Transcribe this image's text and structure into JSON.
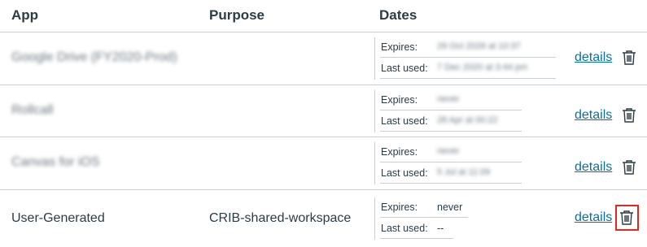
{
  "columns": {
    "app": "App",
    "purpose": "Purpose",
    "dates": "Dates"
  },
  "rows": [
    {
      "app": "Google Drive (FY2020-Prod)",
      "purpose": "",
      "expires_label": "Expires:",
      "expires": "29 Oct 2026 at 10:37",
      "last_used_label": "Last used:",
      "last_used": "7 Dec 2020 at 3:44 pm",
      "details": "details",
      "icon": "trash-icon"
    },
    {
      "app": "Rollcall",
      "purpose": "",
      "expires_label": "Expires:",
      "expires": "never",
      "last_used_label": "Last used:",
      "last_used": "28 Apr at 00:22",
      "details": "details",
      "icon": "trash-icon"
    },
    {
      "app": "Canvas for iOS",
      "purpose": "",
      "expires_label": "Expires:",
      "expires": "never",
      "last_used_label": "Last used:",
      "last_used": "5 Jul at 11:09",
      "details": "details",
      "icon": "trash-icon"
    },
    {
      "app": "User-Generated",
      "purpose": "CRIB-shared-workspace",
      "expires_label": "Expires:",
      "expires": "never",
      "last_used_label": "Last used:",
      "last_used": "--",
      "details": "details",
      "icon": "trash-icon"
    }
  ],
  "colors": {
    "link": "#0770a3",
    "text": "#2d3b45",
    "border": "#c7cdd1",
    "highlight": "#e0281f"
  }
}
